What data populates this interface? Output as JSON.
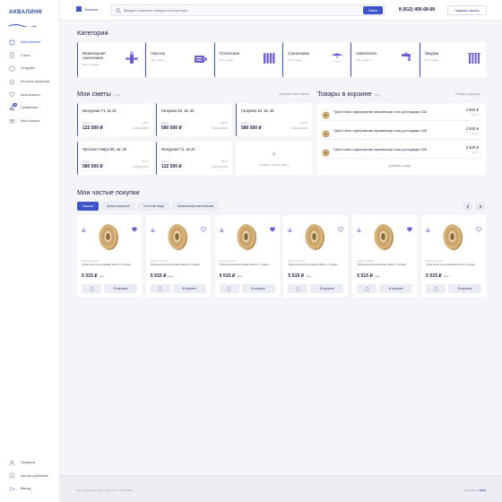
{
  "brand": {
    "logo_text": "АКВАЛИНК"
  },
  "sidebar": {
    "items": [
      {
        "label": "Мой кабинет",
        "icon": "home-icon",
        "active": true
      },
      {
        "label": "Счета",
        "icon": "invoice-icon"
      },
      {
        "label": "Отгрузки",
        "icon": "shipment-icon"
      },
      {
        "label": "История запросов",
        "icon": "history-icon"
      },
      {
        "label": "Мой каталог",
        "icon": "heart-icon"
      },
      {
        "label": "Сравнение",
        "icon": "compare-icon",
        "badge": "36"
      },
      {
        "label": "Мои бонусы",
        "icon": "bonus-icon"
      }
    ],
    "bottom": [
      {
        "label": "Профиль",
        "icon": "user-icon"
      },
      {
        "label": "Как мы работаем",
        "icon": "info-icon"
      },
      {
        "label": "Выход",
        "icon": "logout-icon"
      }
    ]
  },
  "header": {
    "catalog_label": "Каталог",
    "search_placeholder": "Введите название товара или категории",
    "search_button": "Найти",
    "phone": "8 (812) 495-68-68",
    "callback_button": "Заказать звонок"
  },
  "categories": {
    "title": "Категории",
    "items": [
      {
        "name": "Инженерная сантехника",
        "count": "500+ товаров",
        "icon": "valve-icon"
      },
      {
        "name": "Насосы",
        "count": "324 товара",
        "icon": "pump-icon"
      },
      {
        "name": "Отопление",
        "count": "324 товара",
        "icon": "radiator-icon"
      },
      {
        "name": "Сантехника",
        "count": "324 товара",
        "icon": "shower-icon"
      },
      {
        "name": "Смесители",
        "count": "324 товара",
        "icon": "faucet-icon"
      },
      {
        "name": "Экодом",
        "count": "324 товара",
        "icon": "ecohouse-icon"
      }
    ]
  },
  "estimates": {
    "title": "Мои сметы",
    "count": "6 шт",
    "link": "Смотреть все сметы",
    "items": [
      {
        "name": "Менурная 71, кв 43",
        "left_label": "смета",
        "price": "122 500 ₽",
        "right_top": "98 м²",
        "right_bottom": "1 раз купили"
      },
      {
        "name": "Гагарина 64, кв. 26",
        "left_label": "смета",
        "price": "580 500 ₽",
        "right_top": "120 м²",
        "right_bottom": "3 раз купили"
      },
      {
        "name": "Гагарина 64, кв. 26",
        "left_label": "смета",
        "price": "580 500 ₽",
        "right_top": "120 м²",
        "right_bottom": "3 раз купили"
      },
      {
        "name": "Проспект Мира 98, кв. 26",
        "left_label": "смета",
        "price": "580 500 ₽",
        "right_top": "120 м²",
        "right_bottom": "3 раз купили"
      },
      {
        "name": "Менурная 71, кв 43",
        "left_label": "смета",
        "price": "122 500 ₽",
        "right_top": "98 м²",
        "right_bottom": "1 раз купили"
      }
    ],
    "add_label": "Создать новую смету"
  },
  "cart": {
    "title": "Товары в корзине",
    "count": "3 шт",
    "link": "Открыть корзину",
    "items": [
      {
        "name": "Труба Kofulso гофрированная нержавеющая сталь для подводки 1/2М",
        "price": "2 500 ₽",
        "qty": "25 шт"
      },
      {
        "name": "Труба Kofulso гофрированная нержавеющая сталь для подводки 1/2М",
        "price": "2 500 ₽",
        "qty": "25 шт"
      },
      {
        "name": "Труба Kofulso гофрированная нержавеющая сталь для подводки 1/2М",
        "price": "2 500 ₽",
        "qty": "25 шт"
      }
    ],
    "add_label": "Добавить товар"
  },
  "purchases": {
    "title": "Мои частые покупки",
    "filters": [
      {
        "label": "Насосы",
        "active": true
      },
      {
        "label": "Краны шаровые"
      },
      {
        "label": "Счетчики воды"
      },
      {
        "label": "Канализация автономная"
      }
    ],
    "products": [
      {
        "category": "Трубы и фитинги",
        "name": "Труба металлопластиковая VESOL 1 точадин",
        "price": "5 515 ₽",
        "old_price": "13 ₽",
        "cart_label": "В корзине",
        "fav": true
      },
      {
        "category": "Трубы и фитинги",
        "name": "Труба металлопластиковая VESOL 1 точадин",
        "price": "5 515 ₽",
        "old_price": "13 ₽",
        "cart_label": "В корзине",
        "fav": false
      },
      {
        "category": "Трубы и фитинги",
        "name": "Труба металлопластиковая VESOL 1 точадин",
        "price": "5 515 ₽",
        "old_price": "13 ₽",
        "cart_label": "В корзине",
        "fav": true
      },
      {
        "category": "Трубы и фитинги",
        "name": "Труба металлопластиковая VESOL 1 точадин",
        "price": "5 515 ₽",
        "old_price": "13 ₽",
        "cart_label": "В корзине",
        "fav": false
      },
      {
        "category": "Трубы и фитинги",
        "name": "Труба металлопластиковая VESOL 1 точадин",
        "price": "5 515 ₽",
        "old_price": "13 ₽",
        "cart_label": "В корзине",
        "fav": true
      },
      {
        "category": "Трубы и фитинги",
        "name": "Труба металлопластиковая VESOL 1 точадин",
        "price": "5 515 ₽",
        "old_price": "13 ₽",
        "cart_label": "В корзине",
        "fav": false
      }
    ]
  },
  "footer": {
    "copyright": "Все права защищены. Аквалинк © 2000-2021",
    "dev_prefix": "Разработка",
    "dev_name": "TWIN"
  },
  "colors": {
    "accent": "#3e54c9",
    "icon_purple": "#6c5dd3",
    "pipe": "#c9a36a"
  }
}
